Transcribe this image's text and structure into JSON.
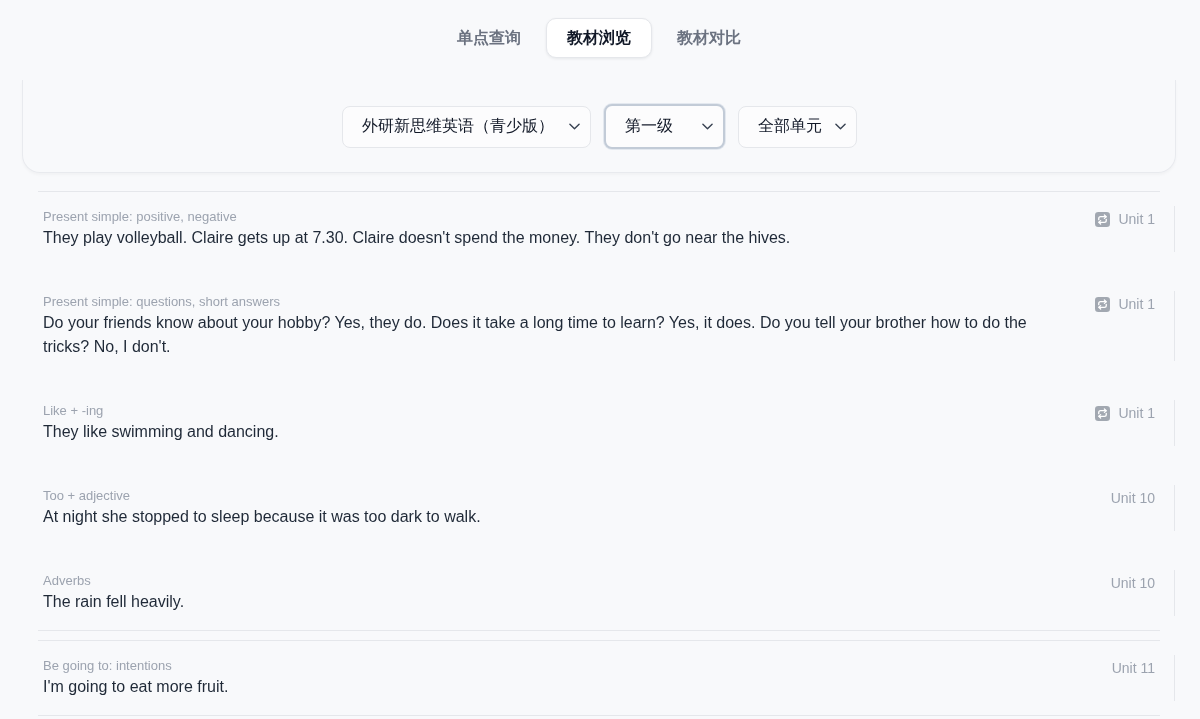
{
  "tabs": [
    {
      "label": "单点查询",
      "selected": false
    },
    {
      "label": "教材浏览",
      "selected": true
    },
    {
      "label": "教材对比",
      "selected": false
    }
  ],
  "filters": [
    {
      "value": "外研新思维英语（青少版）",
      "focused": false
    },
    {
      "value": "第一级",
      "focused": true
    },
    {
      "value": "全部单元",
      "focused": false
    }
  ],
  "groups": [
    {
      "items": [
        {
          "category": "Present simple: positive, negative",
          "sentence": "They play volleyball. Claire gets up at 7.30. Claire doesn't spend the money. They don't go near the hives.",
          "unit": "Unit 1",
          "repeat": true
        },
        {
          "category": "Present simple: questions, short answers",
          "sentence": "Do your friends know about your hobby? Yes, they do. Does it take a long time to learn? Yes, it does. Do you tell your brother how to do the tricks? No, I don't.",
          "unit": "Unit 1",
          "repeat": true
        },
        {
          "category": "Like + -ing",
          "sentence": "They like swimming and dancing.",
          "unit": "Unit 1",
          "repeat": true
        },
        {
          "category": "Too + adjective",
          "sentence": "At night she stopped to sleep because it was too dark to walk.",
          "unit": "Unit 10",
          "repeat": false
        },
        {
          "category": "Adverbs",
          "sentence": "The rain fell heavily.",
          "unit": "Unit 10",
          "repeat": false
        }
      ]
    },
    {
      "items": [
        {
          "category": "Be going to: intentions",
          "sentence": "I'm going to eat more fruit.",
          "unit": "Unit 11",
          "repeat": false
        }
      ]
    }
  ]
}
